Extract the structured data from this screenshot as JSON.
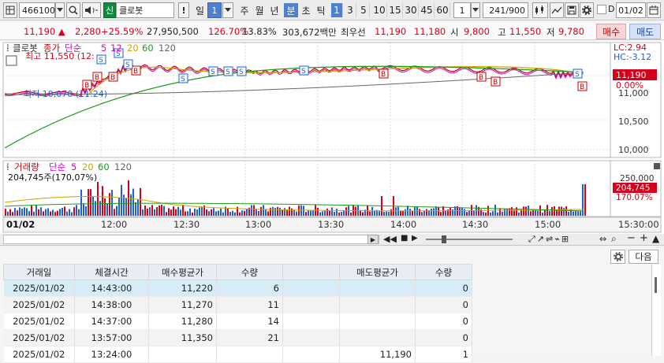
{
  "toolbar": {
    "code": "466100",
    "badge": "신",
    "name": "클로봇",
    "warn": "!",
    "timeframes": [
      "일",
      "주",
      "월",
      "년",
      "분",
      "초",
      "틱"
    ],
    "tf_selected": "분",
    "day_num": "1",
    "minute_buttons": [
      "1",
      "3",
      "5",
      "10",
      "15",
      "30",
      "45",
      "60"
    ],
    "minute_selected": "1",
    "interval": "1",
    "count": "241",
    "count_total": "/900",
    "checkbox_label": "D",
    "date": "01/02"
  },
  "quote": {
    "price": "11,190",
    "change": "2,280",
    "change_pct": "+25.59%",
    "volume": "27,950,500",
    "ratio1": "126.70%",
    "ratio2": "13.83%",
    "amount": "303,672백만",
    "best_label": "최우선",
    "best_ask": "11,190",
    "best_bid": "11,180",
    "open_label": "시",
    "open": "9,800",
    "high_label": "고",
    "high": "11,550",
    "low_label": "저",
    "low": "9,780",
    "buy_label": "매수",
    "sell_label": "매도"
  },
  "price_panel": {
    "title_name": "클로봇",
    "legend": [
      {
        "label": "종가",
        "color": "#c20000"
      },
      {
        "label": "단순",
        "color": "#d100d1"
      },
      {
        "label": "5",
        "color": "#d100d1"
      },
      {
        "label": "12",
        "color": "#d100d1"
      },
      {
        "label": "20",
        "color": "#c9a500"
      },
      {
        "label": "60",
        "color": "#1a9c1a"
      },
      {
        "label": "120",
        "color": "#666666"
      }
    ],
    "high_note": "최고 11,550 (12:",
    "low_note": "최저 10,070 (11:24)",
    "lc": "LC:2.94",
    "hc": "HC:-3.12",
    "price_box": "11,190",
    "pct_box": "0.00%",
    "y_ticks": [
      "11,000",
      "10,500",
      "10,000"
    ]
  },
  "volume_panel": {
    "title": "거래량",
    "ma_label": "단순",
    "ma_values": [
      "5",
      "20",
      "60",
      "120"
    ],
    "ma_colors": [
      "#d100d1",
      "#c9a500",
      "#1a9c1a",
      "#666666"
    ],
    "readout": "204,745주(170,07%)",
    "y_tick": "250,000",
    "vol_box": "204,745",
    "pct_box": "170.07%"
  },
  "x_axis": {
    "date_label": "01/02",
    "ticks": [
      "12:00",
      "12:30",
      "13:00",
      "13:30",
      "14:00",
      "14:30",
      "15:00",
      "15:30:00"
    ]
  },
  "table_toolbar": {
    "next_label": "다음"
  },
  "trades": {
    "headers": [
      "거래일",
      "체결시간",
      "매수평균가",
      "수량",
      "",
      "매도평균가",
      "수량"
    ],
    "rows": [
      {
        "date": "2025/01/02",
        "time": "14:43:00",
        "buy_avg": "11,220",
        "buy_qty": "6",
        "sell_avg": "",
        "sell_qty": "0"
      },
      {
        "date": "2025/01/02",
        "time": "14:38:00",
        "buy_avg": "11,270",
        "buy_qty": "11",
        "sell_avg": "",
        "sell_qty": "0"
      },
      {
        "date": "2025/01/02",
        "time": "14:37:00",
        "buy_avg": "11,280",
        "buy_qty": "14",
        "sell_avg": "",
        "sell_qty": "0"
      },
      {
        "date": "2025/01/02",
        "time": "13:57:00",
        "buy_avg": "11,350",
        "buy_qty": "21",
        "sell_avg": "",
        "sell_qty": "0"
      },
      {
        "date": "2025/01/02",
        "time": "13:24:00",
        "buy_avg": "",
        "buy_qty": "",
        "sell_avg": "11,190",
        "sell_qty": "1"
      }
    ]
  }
}
